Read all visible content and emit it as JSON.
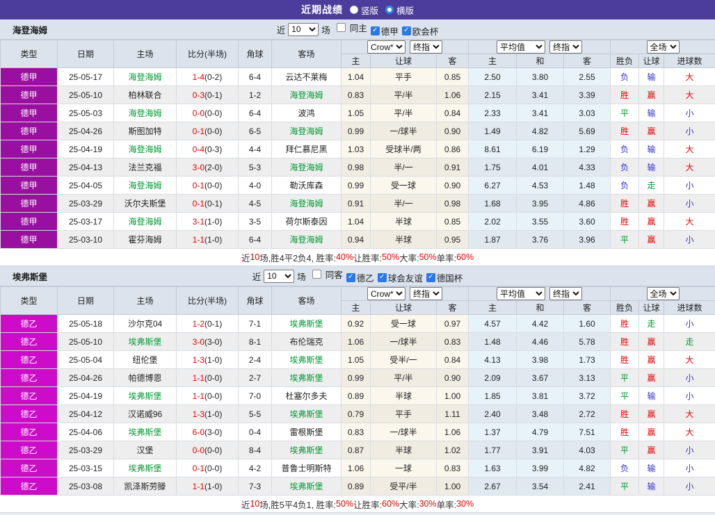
{
  "titlebar": {
    "title": "近期战绩",
    "options": [
      {
        "label": "竖版",
        "selected": false
      },
      {
        "label": "横版",
        "selected": true
      }
    ],
    "bar_color": "#4c3d9c"
  },
  "filter_labels": {
    "near": "近",
    "matches": "场"
  },
  "header": {
    "main_cols": [
      "类型",
      "日期",
      "主场",
      "比分(半场)",
      "角球",
      "客场"
    ],
    "sub_cols": [
      "主",
      "让球",
      "客",
      "主",
      "和",
      "客",
      "胜负",
      "让球",
      "进球数"
    ],
    "selects": {
      "odds_source": "Crow*",
      "odds_final": "终指",
      "avg": "平均值",
      "avg_final": "终指",
      "scope": "全场"
    }
  },
  "result_colors": {
    "r": "#e60000",
    "b": "#3333cc",
    "g": "#009933"
  },
  "sections": [
    {
      "team": "海登海姆",
      "league_color": "#990f9f",
      "filter": {
        "count": "10",
        "checkboxes": [
          {
            "label": "同主",
            "checked": false
          },
          {
            "label": "德甲",
            "checked": true
          },
          {
            "label": "欧会杯",
            "checked": true
          }
        ]
      },
      "rows": [
        {
          "league": "德甲",
          "date": "25-05-17",
          "home": "海登海姆",
          "homeActive": true,
          "score": "1-4",
          "half": "(0-2)",
          "corner": "6-4",
          "away": "云达不莱梅",
          "awayActive": false,
          "odds": [
            "1.04",
            "平手",
            "0.85"
          ],
          "avg": [
            "2.50",
            "3.80",
            "2.55"
          ],
          "result": [
            "负",
            "b"
          ],
          "asian": [
            "输",
            "b"
          ],
          "goals": [
            "大",
            "r"
          ]
        },
        {
          "league": "德甲",
          "date": "25-05-10",
          "home": "柏林联合",
          "homeActive": false,
          "score": "0-3",
          "half": "(0-1)",
          "corner": "1-2",
          "away": "海登海姆",
          "awayActive": true,
          "odds": [
            "0.83",
            "平/半",
            "1.06"
          ],
          "avg": [
            "2.15",
            "3.41",
            "3.39"
          ],
          "result": [
            "胜",
            "r"
          ],
          "asian": [
            "赢",
            "r"
          ],
          "goals": [
            "大",
            "r"
          ]
        },
        {
          "league": "德甲",
          "date": "25-05-03",
          "home": "海登海姆",
          "homeActive": true,
          "score": "0-0",
          "half": "(0-0)",
          "corner": "6-4",
          "away": "波鸿",
          "awayActive": false,
          "odds": [
            "1.05",
            "平/半",
            "0.84"
          ],
          "avg": [
            "2.33",
            "3.41",
            "3.03"
          ],
          "result": [
            "平",
            "g"
          ],
          "asian": [
            "输",
            "b"
          ],
          "goals": [
            "小",
            "b"
          ]
        },
        {
          "league": "德甲",
          "date": "25-04-26",
          "home": "斯图加特",
          "homeActive": false,
          "score": "0-1",
          "half": "(0-0)",
          "corner": "6-5",
          "away": "海登海姆",
          "awayActive": true,
          "odds": [
            "0.99",
            "一/球半",
            "0.90"
          ],
          "avg": [
            "1.49",
            "4.82",
            "5.69"
          ],
          "result": [
            "胜",
            "r"
          ],
          "asian": [
            "赢",
            "r"
          ],
          "goals": [
            "小",
            "b"
          ]
        },
        {
          "league": "德甲",
          "date": "25-04-19",
          "home": "海登海姆",
          "homeActive": true,
          "score": "0-4",
          "half": "(0-3)",
          "corner": "4-4",
          "away": "拜仁慕尼黑",
          "awayActive": false,
          "odds": [
            "1.03",
            "受球半/两",
            "0.86"
          ],
          "avg": [
            "8.61",
            "6.19",
            "1.29"
          ],
          "result": [
            "负",
            "b"
          ],
          "asian": [
            "输",
            "b"
          ],
          "goals": [
            "大",
            "r"
          ]
        },
        {
          "league": "德甲",
          "date": "25-04-13",
          "home": "法兰克福",
          "homeActive": false,
          "score": "3-0",
          "half": "(2-0)",
          "corner": "5-3",
          "away": "海登海姆",
          "awayActive": true,
          "odds": [
            "0.98",
            "半/一",
            "0.91"
          ],
          "avg": [
            "1.75",
            "4.01",
            "4.33"
          ],
          "result": [
            "负",
            "b"
          ],
          "asian": [
            "输",
            "b"
          ],
          "goals": [
            "大",
            "r"
          ]
        },
        {
          "league": "德甲",
          "date": "25-04-05",
          "home": "海登海姆",
          "homeActive": true,
          "score": "0-1",
          "half": "(0-0)",
          "corner": "4-0",
          "away": "勒沃库森",
          "awayActive": false,
          "odds": [
            "0.99",
            "受一球",
            "0.90"
          ],
          "avg": [
            "6.27",
            "4.53",
            "1.48"
          ],
          "result": [
            "负",
            "b"
          ],
          "asian": [
            "走",
            "g"
          ],
          "goals": [
            "小",
            "b"
          ]
        },
        {
          "league": "德甲",
          "date": "25-03-29",
          "home": "沃尔夫斯堡",
          "homeActive": false,
          "score": "0-1",
          "half": "(0-1)",
          "corner": "4-5",
          "away": "海登海姆",
          "awayActive": true,
          "odds": [
            "0.91",
            "半/一",
            "0.98"
          ],
          "avg": [
            "1.68",
            "3.95",
            "4.86"
          ],
          "result": [
            "胜",
            "r"
          ],
          "asian": [
            "赢",
            "r"
          ],
          "goals": [
            "小",
            "b"
          ]
        },
        {
          "league": "德甲",
          "date": "25-03-17",
          "home": "海登海姆",
          "homeActive": true,
          "score": "3-1",
          "half": "(1-0)",
          "corner": "3-5",
          "away": "荷尔斯泰因",
          "awayActive": false,
          "odds": [
            "1.04",
            "半球",
            "0.85"
          ],
          "avg": [
            "2.02",
            "3.55",
            "3.60"
          ],
          "result": [
            "胜",
            "r"
          ],
          "asian": [
            "赢",
            "r"
          ],
          "goals": [
            "大",
            "r"
          ]
        },
        {
          "league": "德甲",
          "date": "25-03-10",
          "home": "霍芬海姆",
          "homeActive": false,
          "score": "1-1",
          "half": "(1-0)",
          "corner": "6-4",
          "away": "海登海姆",
          "awayActive": true,
          "odds": [
            "0.94",
            "半球",
            "0.95"
          ],
          "avg": [
            "1.87",
            "3.76",
            "3.96"
          ],
          "result": [
            "平",
            "g"
          ],
          "asian": [
            "赢",
            "r"
          ],
          "goals": [
            "小",
            "b"
          ]
        }
      ],
      "summary": [
        [
          "近",
          false
        ],
        [
          "10",
          true
        ],
        [
          "场,胜4平2负4, 胜率:",
          false
        ],
        [
          "40%",
          true
        ],
        [
          " 让胜率:",
          false
        ],
        [
          "50%",
          true
        ],
        [
          " 大率:",
          false
        ],
        [
          "50%",
          true
        ],
        [
          " 单率:",
          false
        ],
        [
          "60%",
          true
        ]
      ]
    },
    {
      "team": "埃弗斯堡",
      "league_color": "#cc0cc8",
      "filter": {
        "count": "10",
        "checkboxes": [
          {
            "label": "同客",
            "checked": false
          },
          {
            "label": "德乙",
            "checked": true
          },
          {
            "label": "球会友谊",
            "checked": true
          },
          {
            "label": "德国杯",
            "checked": true
          }
        ]
      },
      "rows": [
        {
          "league": "德乙",
          "date": "25-05-18",
          "home": "沙尔克04",
          "homeActive": false,
          "score": "1-2",
          "half": "(0-1)",
          "corner": "7-1",
          "away": "埃弗斯堡",
          "awayActive": true,
          "odds": [
            "0.92",
            "受一球",
            "0.97"
          ],
          "avg": [
            "4.57",
            "4.42",
            "1.60"
          ],
          "result": [
            "胜",
            "r"
          ],
          "asian": [
            "走",
            "g"
          ],
          "goals": [
            "小",
            "b"
          ]
        },
        {
          "league": "德乙",
          "date": "25-05-10",
          "home": "埃弗斯堡",
          "homeActive": true,
          "score": "3-0",
          "half": "(3-0)",
          "corner": "8-1",
          "away": "布伦瑞克",
          "awayActive": false,
          "odds": [
            "1.06",
            "一/球半",
            "0.83"
          ],
          "avg": [
            "1.48",
            "4.46",
            "5.78"
          ],
          "result": [
            "胜",
            "r"
          ],
          "asian": [
            "赢",
            "r"
          ],
          "goals": [
            "走",
            "g"
          ]
        },
        {
          "league": "德乙",
          "date": "25-05-04",
          "home": "纽伦堡",
          "homeActive": false,
          "score": "1-3",
          "half": "(1-0)",
          "corner": "2-4",
          "away": "埃弗斯堡",
          "awayActive": true,
          "odds": [
            "1.05",
            "受半/一",
            "0.84"
          ],
          "avg": [
            "4.13",
            "3.98",
            "1.73"
          ],
          "result": [
            "胜",
            "r"
          ],
          "asian": [
            "赢",
            "r"
          ],
          "goals": [
            "大",
            "r"
          ]
        },
        {
          "league": "德乙",
          "date": "25-04-26",
          "home": "帕德博恩",
          "homeActive": false,
          "score": "1-1",
          "half": "(0-0)",
          "corner": "2-7",
          "away": "埃弗斯堡",
          "awayActive": true,
          "odds": [
            "0.99",
            "平/半",
            "0.90"
          ],
          "avg": [
            "2.09",
            "3.67",
            "3.13"
          ],
          "result": [
            "平",
            "g"
          ],
          "asian": [
            "赢",
            "r"
          ],
          "goals": [
            "小",
            "b"
          ]
        },
        {
          "league": "德乙",
          "date": "25-04-19",
          "home": "埃弗斯堡",
          "homeActive": true,
          "score": "1-1",
          "half": "(0-0)",
          "corner": "7-0",
          "away": "杜塞尔多夫",
          "awayActive": false,
          "odds": [
            "0.89",
            "半球",
            "1.00"
          ],
          "avg": [
            "1.85",
            "3.81",
            "3.72"
          ],
          "result": [
            "平",
            "g"
          ],
          "asian": [
            "输",
            "b"
          ],
          "goals": [
            "小",
            "b"
          ]
        },
        {
          "league": "德乙",
          "date": "25-04-12",
          "home": "汉诺威96",
          "homeActive": false,
          "score": "1-3",
          "half": "(1-0)",
          "corner": "5-5",
          "away": "埃弗斯堡",
          "awayActive": true,
          "odds": [
            "0.79",
            "平手",
            "1.11"
          ],
          "avg": [
            "2.40",
            "3.48",
            "2.72"
          ],
          "result": [
            "胜",
            "r"
          ],
          "asian": [
            "赢",
            "r"
          ],
          "goals": [
            "大",
            "r"
          ]
        },
        {
          "league": "德乙",
          "date": "25-04-06",
          "home": "埃弗斯堡",
          "homeActive": true,
          "score": "6-0",
          "half": "(3-0)",
          "corner": "0-4",
          "away": "雷根斯堡",
          "awayActive": false,
          "odds": [
            "0.83",
            "一/球半",
            "1.06"
          ],
          "avg": [
            "1.37",
            "4.79",
            "7.51"
          ],
          "result": [
            "胜",
            "r"
          ],
          "asian": [
            "赢",
            "r"
          ],
          "goals": [
            "大",
            "r"
          ]
        },
        {
          "league": "德乙",
          "date": "25-03-29",
          "home": "汉堡",
          "homeActive": false,
          "score": "0-0",
          "half": "(0-0)",
          "corner": "8-4",
          "away": "埃弗斯堡",
          "awayActive": true,
          "odds": [
            "0.87",
            "半球",
            "1.02"
          ],
          "avg": [
            "1.77",
            "3.91",
            "4.03"
          ],
          "result": [
            "平",
            "g"
          ],
          "asian": [
            "赢",
            "r"
          ],
          "goals": [
            "小",
            "b"
          ]
        },
        {
          "league": "德乙",
          "date": "25-03-15",
          "home": "埃弗斯堡",
          "homeActive": true,
          "score": "0-1",
          "half": "(0-0)",
          "corner": "4-2",
          "away": "普鲁士明斯特",
          "awayActive": false,
          "odds": [
            "1.06",
            "一球",
            "0.83"
          ],
          "avg": [
            "1.63",
            "3.99",
            "4.82"
          ],
          "result": [
            "负",
            "b"
          ],
          "asian": [
            "输",
            "b"
          ],
          "goals": [
            "小",
            "b"
          ]
        },
        {
          "league": "德乙",
          "date": "25-03-08",
          "home": "凯泽斯劳滕",
          "homeActive": false,
          "score": "1-1",
          "half": "(1-0)",
          "corner": "7-3",
          "away": "埃弗斯堡",
          "awayActive": true,
          "odds": [
            "0.89",
            "受平/半",
            "1.00"
          ],
          "avg": [
            "2.67",
            "3.54",
            "2.41"
          ],
          "result": [
            "平",
            "g"
          ],
          "asian": [
            "输",
            "b"
          ],
          "goals": [
            "小",
            "b"
          ]
        }
      ],
      "summary": [
        [
          "近",
          false
        ],
        [
          "10",
          true
        ],
        [
          "场,胜5平4负1, 胜率:",
          false
        ],
        [
          "50%",
          true
        ],
        [
          " 让胜率:",
          false
        ],
        [
          "60%",
          true
        ],
        [
          " 大率:",
          false
        ],
        [
          "30%",
          true
        ],
        [
          " 单率:",
          false
        ],
        [
          "30%",
          true
        ]
      ]
    }
  ]
}
